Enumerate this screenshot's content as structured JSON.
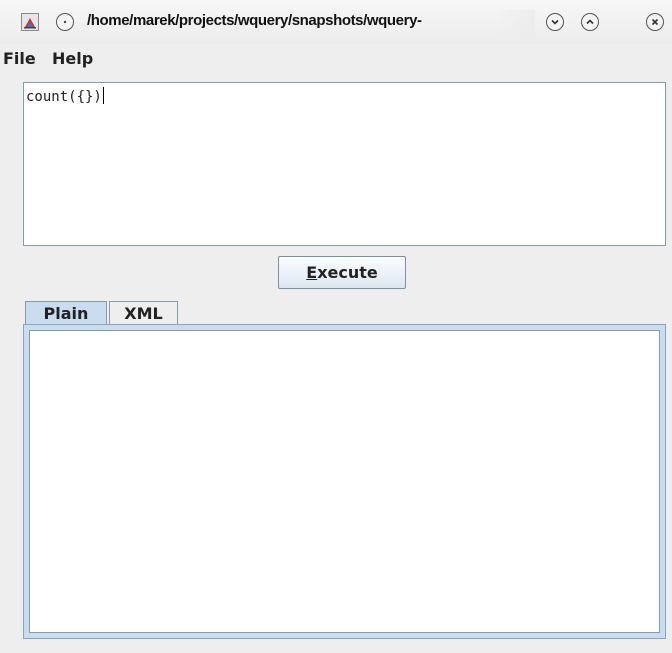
{
  "window": {
    "title": "/home/marek/projects/wquery/snapshots/wquery-",
    "icons": [
      "java-app-icon",
      "window-menu-icon",
      "minimize-icon",
      "maximize-icon",
      "close-icon"
    ]
  },
  "menubar": {
    "items": [
      {
        "label": "File"
      },
      {
        "label": "Help"
      }
    ]
  },
  "query": {
    "value": "count({})"
  },
  "execute_button": {
    "mnemonic": "E",
    "rest": "xecute"
  },
  "tabs": [
    {
      "label": "Plain",
      "selected": true
    },
    {
      "label": "XML",
      "selected": false
    }
  ],
  "result": {
    "text": ""
  },
  "colors": {
    "tab_selected": "#c9dcf0",
    "border": "#8a99a6",
    "background": "#eeeeee"
  }
}
